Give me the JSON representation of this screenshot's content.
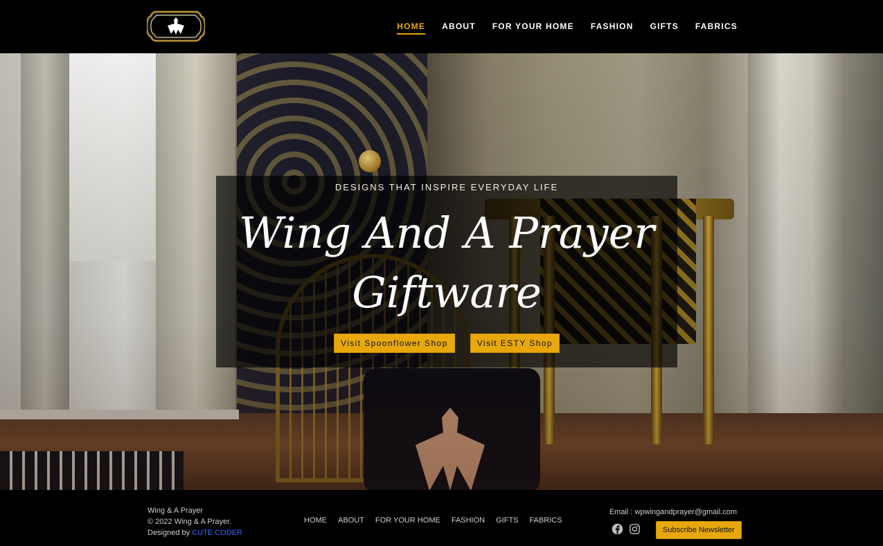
{
  "header": {
    "nav": [
      {
        "label": "HOME",
        "active": true
      },
      {
        "label": "ABOUT"
      },
      {
        "label": "FOR YOUR HOME"
      },
      {
        "label": "FASHION"
      },
      {
        "label": "GIFTS"
      },
      {
        "label": "FABRICS"
      }
    ]
  },
  "hero": {
    "eyebrow": "DESIGNS THAT INSPIRE EVERYDAY LIFE",
    "title_line1": "Wing And A Prayer",
    "title_line2": "Giftware",
    "buttons": [
      {
        "label": "Visit Spoonflower Shop"
      },
      {
        "label": "Visit ESTY Shop"
      }
    ]
  },
  "footer": {
    "brand": "Wing & A Prayer",
    "copyright": "© 2022 Wing & A Prayer.",
    "designed_by_prefix": "Designed by",
    "designer": "CUTE CODER",
    "nav": [
      "HOME",
      "ABOUT",
      "FOR YOUR HOME",
      "FASHION",
      "GIFTS",
      "FABRICS"
    ],
    "email": "Email : wpwingandprayer@gmail.com",
    "social_icons": [
      "facebook-icon",
      "instagram-icon"
    ],
    "subscribe_label": "Subscribe Newsletter"
  },
  "colors": {
    "accent": "#e8a80c",
    "header_bg": "#000000",
    "link_blue": "#3a64ff"
  }
}
